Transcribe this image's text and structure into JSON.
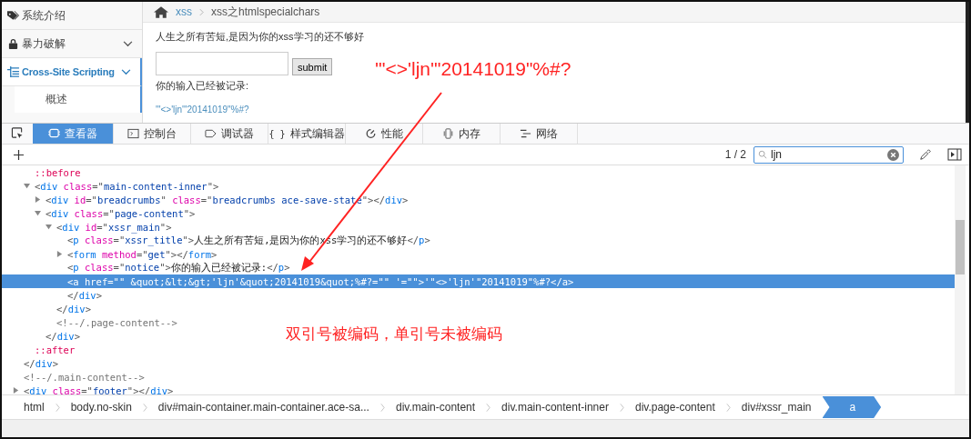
{
  "sidebar": {
    "items": [
      {
        "label": "系统介绍",
        "expandable": false,
        "selected": false
      },
      {
        "label": "暴力破解",
        "expandable": true,
        "selected": false
      },
      {
        "label": "Cross-Site Scripting",
        "expandable": true,
        "selected": true,
        "children": [
          {
            "label": "概述",
            "selected": false
          }
        ]
      }
    ]
  },
  "page": {
    "breadcrumbs": [
      {
        "label": "xss",
        "kind": "link"
      },
      {
        "label": "xss之htmlspecialchars",
        "kind": "current"
      }
    ],
    "title": "人生之所有苦短,是因为你的xss学习的还不够好",
    "button": "submit",
    "notice": "你的输入已经被记录:",
    "output_link": "'\"<>'ljn'\"20141019\"%#?"
  },
  "annotations": [
    {
      "kind": "callout",
      "text": "'\"<>'ljn'\"20141019\"%#?"
    },
    {
      "kind": "note",
      "text": "双引号被编码，单引号未被编码"
    }
  ],
  "devtools": {
    "tabs": [
      {
        "label": "查看器",
        "selected": true
      },
      {
        "label": "控制台",
        "selected": false
      },
      {
        "label": "调试器",
        "selected": false
      },
      {
        "label": "样式编辑器",
        "glyph": "{ }",
        "selected": false
      },
      {
        "label": "性能",
        "selected": false
      },
      {
        "label": "内存",
        "selected": false
      },
      {
        "label": "网络",
        "selected": false
      }
    ],
    "search": {
      "count": "1 / 2",
      "value": "ljn"
    },
    "tree": [
      {
        "children": [
          {
            "tokens": [
              {
                "kind": "pseudo",
                "text": "::before"
              }
            ],
            "selected": false
          },
          {
            "tokens": [
              {
                "kind": "punct",
                "text": "<"
              },
              {
                "kind": "tag",
                "text": "div"
              },
              {
                "kind": "attr",
                "text": " class"
              },
              {
                "kind": "punct",
                "text": "=\""
              },
              {
                "kind": "value",
                "text": "main-content-inner"
              },
              {
                "kind": "punct",
                "text": "\">"
              }
            ],
            "expanded": true,
            "selected": false,
            "children": [
              {
                "tokens": [
                  {
                    "kind": "punct",
                    "text": "<"
                  },
                  {
                    "kind": "tag",
                    "text": "div"
                  },
                  {
                    "kind": "attr",
                    "text": " id"
                  },
                  {
                    "kind": "punct",
                    "text": "=\""
                  },
                  {
                    "kind": "value",
                    "text": "breadcrumbs"
                  },
                  {
                    "kind": "punct",
                    "text": "\" "
                  },
                  {
                    "kind": "attr",
                    "text": "class"
                  },
                  {
                    "kind": "punct",
                    "text": "=\""
                  },
                  {
                    "kind": "value",
                    "text": "breadcrumbs ace-save-state"
                  },
                  {
                    "kind": "punct",
                    "text": "\"></"
                  },
                  {
                    "kind": "tag",
                    "text": "div"
                  },
                  {
                    "kind": "punct",
                    "text": ">"
                  }
                ],
                "expanded": false,
                "selected": false
              },
              {
                "tokens": [
                  {
                    "kind": "punct",
                    "text": "<"
                  },
                  {
                    "kind": "tag",
                    "text": "div"
                  },
                  {
                    "kind": "attr",
                    "text": " class"
                  },
                  {
                    "kind": "punct",
                    "text": "=\""
                  },
                  {
                    "kind": "value",
                    "text": "page-content"
                  },
                  {
                    "kind": "punct",
                    "text": "\">"
                  }
                ],
                "expanded": true,
                "selected": false,
                "children": [
                  {
                    "tokens": [
                      {
                        "kind": "punct",
                        "text": "<"
                      },
                      {
                        "kind": "tag",
                        "text": "div"
                      },
                      {
                        "kind": "attr",
                        "text": " id"
                      },
                      {
                        "kind": "punct",
                        "text": "=\""
                      },
                      {
                        "kind": "value",
                        "text": "xssr_main"
                      },
                      {
                        "kind": "punct",
                        "text": "\">"
                      }
                    ],
                    "expanded": true,
                    "selected": false,
                    "children": [
                      {
                        "tokens": [
                          {
                            "kind": "punct",
                            "text": "<"
                          },
                          {
                            "kind": "tag",
                            "text": "p"
                          },
                          {
                            "kind": "attr",
                            "text": " class"
                          },
                          {
                            "kind": "punct",
                            "text": "=\""
                          },
                          {
                            "kind": "value",
                            "text": "xssr_title"
                          },
                          {
                            "kind": "punct",
                            "text": "\">"
                          },
                          {
                            "kind": "text",
                            "text": "人生之所有苦短,是因为你的xss学习的还不够好"
                          },
                          {
                            "kind": "punct",
                            "text": "</"
                          },
                          {
                            "kind": "tag",
                            "text": "p"
                          },
                          {
                            "kind": "punct",
                            "text": ">"
                          }
                        ],
                        "selected": false
                      },
                      {
                        "tokens": [
                          {
                            "kind": "punct",
                            "text": "<"
                          },
                          {
                            "kind": "tag",
                            "text": "form"
                          },
                          {
                            "kind": "attr",
                            "text": " method"
                          },
                          {
                            "kind": "punct",
                            "text": "=\""
                          },
                          {
                            "kind": "value",
                            "text": "get"
                          },
                          {
                            "kind": "punct",
                            "text": "\"></"
                          },
                          {
                            "kind": "tag",
                            "text": "form"
                          },
                          {
                            "kind": "punct",
                            "text": ">"
                          }
                        ],
                        "expanded": false,
                        "selected": false
                      },
                      {
                        "tokens": [
                          {
                            "kind": "punct",
                            "text": "<"
                          },
                          {
                            "kind": "tag",
                            "text": "p"
                          },
                          {
                            "kind": "attr",
                            "text": " class"
                          },
                          {
                            "kind": "punct",
                            "text": "=\""
                          },
                          {
                            "kind": "value",
                            "text": "notice"
                          },
                          {
                            "kind": "punct",
                            "text": "\">"
                          },
                          {
                            "kind": "text",
                            "text": "你的输入已经被记录:"
                          },
                          {
                            "kind": "punct",
                            "text": "</"
                          },
                          {
                            "kind": "tag",
                            "text": "p"
                          },
                          {
                            "kind": "punct",
                            "text": ">"
                          }
                        ],
                        "selected": false
                      },
                      {
                        "tokens": [
                          {
                            "kind": "punct",
                            "text": "<"
                          },
                          {
                            "kind": "tag",
                            "text": "a"
                          },
                          {
                            "kind": "attr",
                            "text": " href"
                          },
                          {
                            "kind": "punct",
                            "text": "=\"\" "
                          },
                          {
                            "kind": "attr",
                            "text": "&quot;&lt;&gt;'ljn'&quot;20141019&quot;%#?"
                          },
                          {
                            "kind": "punct",
                            "text": "=\"\" "
                          },
                          {
                            "kind": "attr",
                            "text": "'"
                          },
                          {
                            "kind": "punct",
                            "text": "=\"\">"
                          },
                          {
                            "kind": "text",
                            "text": "'\"<>'ljn'\"20141019\"%#?"
                          },
                          {
                            "kind": "punct",
                            "text": "</"
                          },
                          {
                            "kind": "tag",
                            "text": "a"
                          },
                          {
                            "kind": "punct",
                            "text": ">"
                          }
                        ],
                        "selected": true
                      },
                      {
                        "tokens": [
                          {
                            "kind": "punct",
                            "text": "</"
                          },
                          {
                            "kind": "tag",
                            "text": "div"
                          },
                          {
                            "kind": "punct",
                            "text": ">"
                          }
                        ],
                        "selected": false
                      }
                    ]
                  },
                  {
                    "tokens": [
                      {
                        "kind": "punct",
                        "text": "</"
                      },
                      {
                        "kind": "tag",
                        "text": "div"
                      },
                      {
                        "kind": "punct",
                        "text": ">"
                      }
                    ],
                    "selected": false
                  },
                  {
                    "tokens": [
                      {
                        "kind": "comment",
                        "text": "<!--/.page-content-->"
                      }
                    ],
                    "selected": false
                  }
                ]
              },
              {
                "tokens": [
                  {
                    "kind": "punct",
                    "text": "</"
                  },
                  {
                    "kind": "tag",
                    "text": "div"
                  },
                  {
                    "kind": "punct",
                    "text": ">"
                  }
                ],
                "selected": false
              }
            ]
          },
          {
            "tokens": [
              {
                "kind": "pseudo",
                "text": "::after"
              }
            ],
            "selected": false
          }
        ]
      },
      {
        "tokens": [
          {
            "kind": "punct",
            "text": "</"
          },
          {
            "kind": "tag",
            "text": "div"
          },
          {
            "kind": "punct",
            "text": ">"
          }
        ],
        "selected": false
      },
      {
        "tokens": [
          {
            "kind": "comment",
            "text": "<!--/.main-content-->"
          }
        ],
        "selected": false
      },
      {
        "tokens": [
          {
            "kind": "punct",
            "text": "<"
          },
          {
            "kind": "tag",
            "text": "div"
          },
          {
            "kind": "attr",
            "text": " class"
          },
          {
            "kind": "punct",
            "text": "=\""
          },
          {
            "kind": "value",
            "text": "footer"
          },
          {
            "kind": "punct",
            "text": "\"></"
          },
          {
            "kind": "tag",
            "text": "div"
          },
          {
            "kind": "punct",
            "text": ">"
          }
        ],
        "expanded": false,
        "selected": false
      }
    ],
    "path": [
      {
        "label": "html",
        "selected": false
      },
      {
        "label": "body.no-skin",
        "selected": false
      },
      {
        "label": "div#main-container.main-container.ace-sa...",
        "selected": false
      },
      {
        "label": "div.main-content",
        "selected": false
      },
      {
        "label": "div.main-content-inner",
        "selected": false
      },
      {
        "label": "div.page-content",
        "selected": false
      },
      {
        "label": "div#xssr_main",
        "selected": false
      },
      {
        "label": "a",
        "selected": true
      }
    ]
  }
}
